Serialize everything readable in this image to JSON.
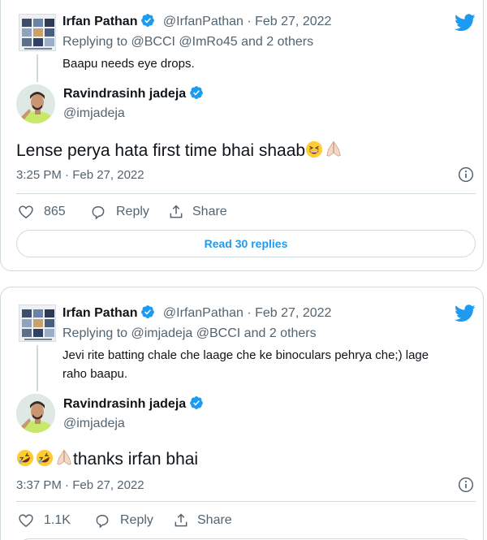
{
  "tweets": [
    {
      "parent": {
        "name": "Irfan Pathan",
        "handle": "@IrfanPathan",
        "date": "· Feb 27, 2022",
        "replying_to": "Replying to @BCCI @ImRo45 and 2 others",
        "text_lines": [
          "Baapu needs eye drops."
        ]
      },
      "reply": {
        "name": "Ravindrasinh jadeja",
        "handle": "@imjadeja",
        "text": "Lense perya hata first time bhai shaab",
        "timestamp": "3:25 PM · Feb 27, 2022"
      },
      "actions": {
        "like_count": "865",
        "reply_label": "Reply",
        "share_label": "Share"
      },
      "read_replies": "Read 30 replies"
    },
    {
      "parent": {
        "name": "Irfan Pathan",
        "handle": "@IrfanPathan",
        "date": "· Feb 27, 2022",
        "replying_to": "Replying to @imjadeja @BCCI and 2 others",
        "text_lines": [
          "Jevi rite batting chale che laage che ke binoculars pehrya che;) lage",
          "raho baapu."
        ]
      },
      "reply": {
        "name": "Ravindrasinh jadeja",
        "handle": "@imjadeja",
        "text": "thanks irfan bhai",
        "timestamp": "3:37 PM · Feb 27, 2022"
      },
      "actions": {
        "like_count": "1.1K",
        "reply_label": "Reply",
        "share_label": "Share"
      }
    }
  ],
  "colors": {
    "brand_blue": "#1d9bf0",
    "text_primary": "#0f1419",
    "text_secondary": "#536471",
    "border": "#cfd9de",
    "verified_blue": "#1d9bf0"
  },
  "icons": {
    "logo": "twitter-bird-icon",
    "verified": "verified-badge-icon",
    "info": "info-icon",
    "like": "heart-icon",
    "reply": "reply-bubble-icon",
    "share": "share-icon",
    "emoji_laugh": "grinning-squinting-face-emoji",
    "emoji_pray": "folded-hands-emoji",
    "emoji_rofl": "rolling-on-floor-laughing-emoji"
  }
}
